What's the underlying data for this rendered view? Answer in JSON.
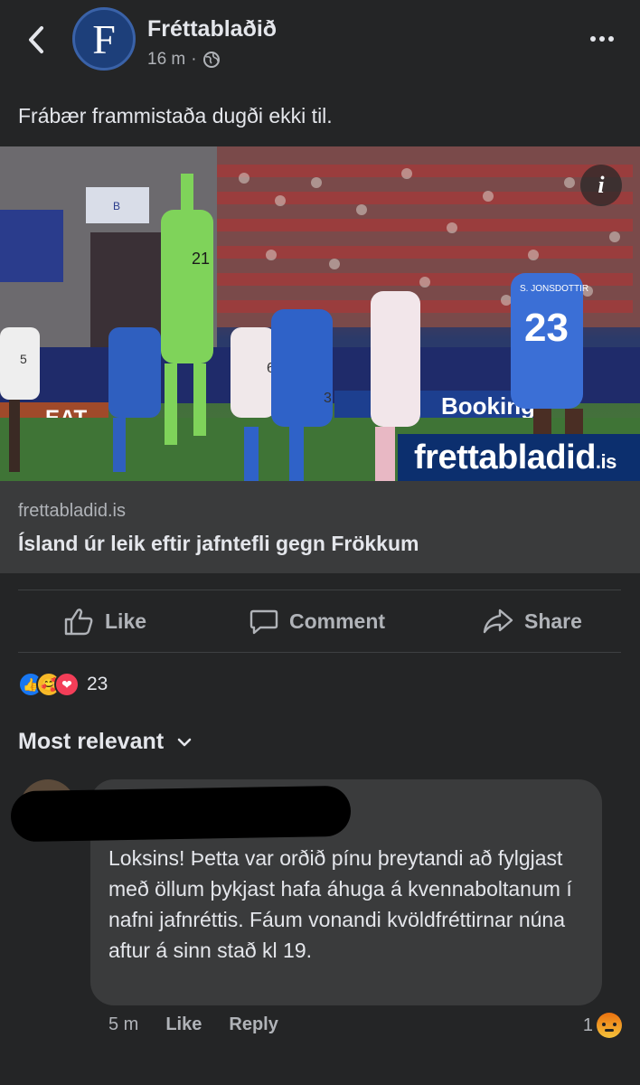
{
  "header": {
    "page_name": "Fréttablaðið",
    "avatar_letter": "F",
    "time": "16 m",
    "separator": "·",
    "privacy_icon": "globe-icon"
  },
  "post": {
    "caption": "Frábær frammistaða dugði ekki til.",
    "photo": {
      "info_label": "i",
      "watermark_main": "frettabladid",
      "watermark_suffix": ".is",
      "jersey_numbers": [
        "5",
        "21",
        "6",
        "3",
        "23"
      ],
      "jersey_name": "S. JONSDOTTIR",
      "board_texts": [
        "EAT",
        "Booking",
        "B"
      ]
    },
    "link": {
      "domain": "frettabladid.is",
      "title": "Ísland úr leik eftir jafntefli gegn Frökkum"
    }
  },
  "actions": {
    "like": "Like",
    "comment": "Comment",
    "share": "Share"
  },
  "reactions": {
    "count": "23",
    "types": [
      "like-icon",
      "care-icon",
      "love-icon"
    ]
  },
  "comments_sort": {
    "label": "Most relevant"
  },
  "comment": {
    "text": "Loksins! Þetta var orðið pínu þreytandi að fylgjast með öllum þykjast hafa áhuga á kvennaboltanum í nafni jafnréttis. Fáum vonandi kvöldfréttirnar núna aftur á sinn stað kl 19.",
    "time": "5 m",
    "like": "Like",
    "reply": "Reply",
    "reaction_count": "1",
    "reaction_icon": "angry-icon"
  },
  "colors": {
    "background": "#242526",
    "surface": "#3a3b3c",
    "text_primary": "#e4e6eb",
    "text_secondary": "#b0b3b8",
    "accent_blue": "#1877f2",
    "brand_navy": "#0c2f6e"
  }
}
